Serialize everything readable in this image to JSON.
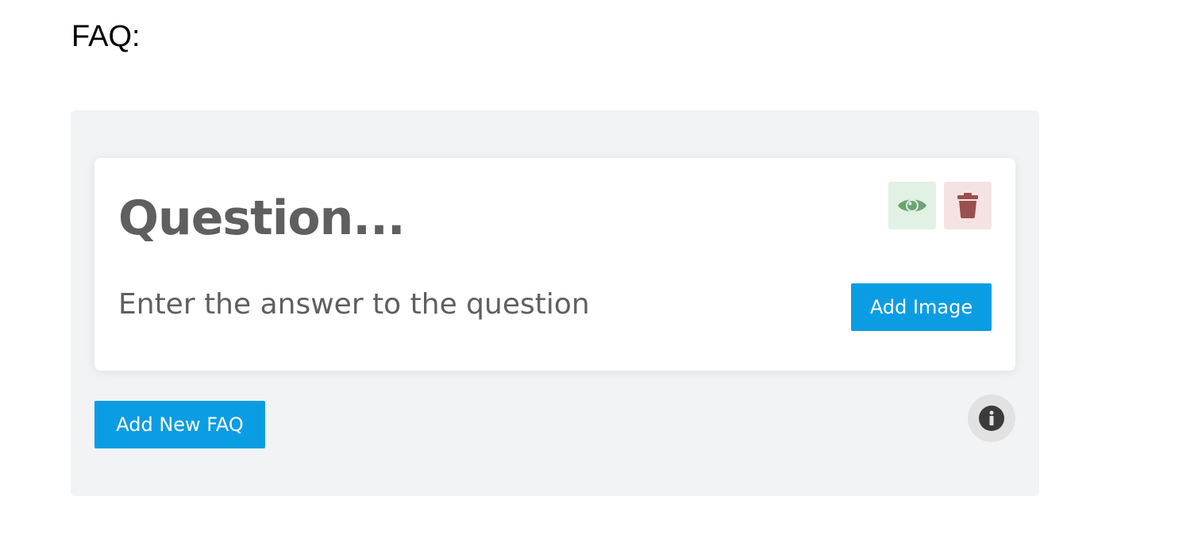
{
  "page": {
    "heading": "FAQ:"
  },
  "faq_item": {
    "question_placeholder": "Question...",
    "question_value": "",
    "answer_placeholder": "Enter the answer to the question",
    "answer_value": "",
    "add_image_label": "Add Image",
    "view_icon": "eye-icon",
    "delete_icon": "trash-icon"
  },
  "panel": {
    "add_new_faq_label": "Add New FAQ",
    "info_icon": "info-icon"
  },
  "colors": {
    "accent_button": "#0b9de3",
    "view_button_bg": "#e1f1e3",
    "view_icon": "#6da374",
    "delete_button_bg": "#f5e3e3",
    "delete_icon": "#9b4f4f",
    "info_button_bg": "#e2e2e2",
    "info_icon": "#3b3b3b",
    "panel_bg": "#f2f3f5"
  }
}
